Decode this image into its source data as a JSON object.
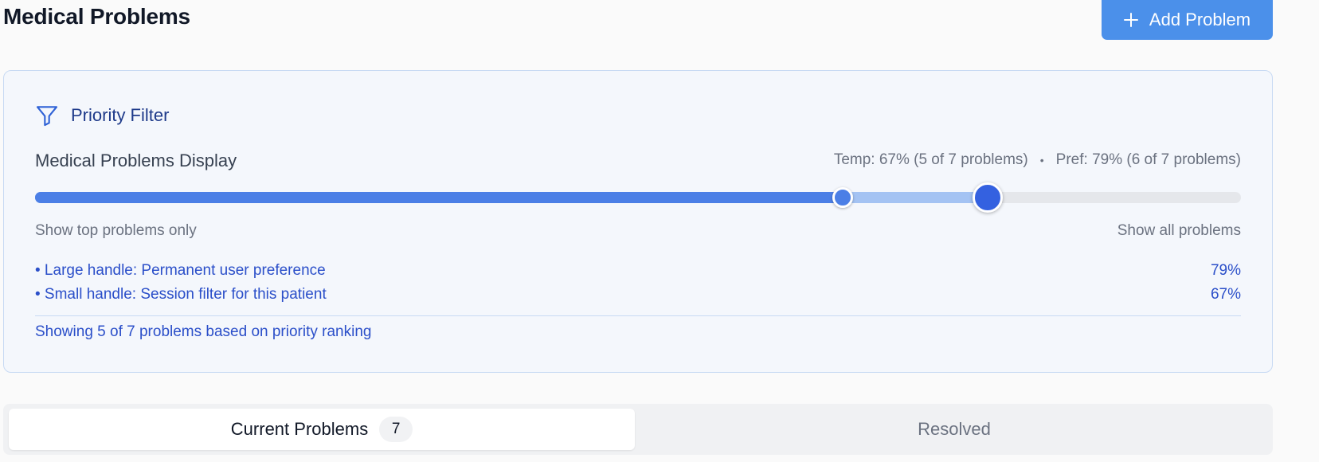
{
  "header": {
    "title": "Medical Problems",
    "add_button_label": "Add Problem"
  },
  "priority_filter": {
    "title": "Priority Filter",
    "display_label": "Medical Problems Display",
    "temp_status": "Temp: 67% (5 of 7 problems)",
    "separator": "•",
    "pref_status": "Pref: 79% (6 of 7 problems)",
    "slider": {
      "temp_percent": 67,
      "pref_percent": 79
    },
    "range_min_label": "Show top problems only",
    "range_max_label": "Show all problems",
    "legend": [
      {
        "label": "• Large handle: Permanent user preference",
        "value": "79%"
      },
      {
        "label": "• Small handle: Session filter for this patient",
        "value": "67%"
      }
    ],
    "summary": "Showing 5 of 7 problems based on priority ranking"
  },
  "tabs": {
    "current_label": "Current Problems",
    "current_count": "7",
    "resolved_label": "Resolved"
  },
  "colors": {
    "primary_button": "#4b90ea",
    "temp_fill": "#4b7fe6",
    "pref_fill": "#a4c3f3",
    "accent_text": "#2b4fc9"
  },
  "icons": {
    "add": "plus-icon",
    "filter": "funnel-icon"
  }
}
